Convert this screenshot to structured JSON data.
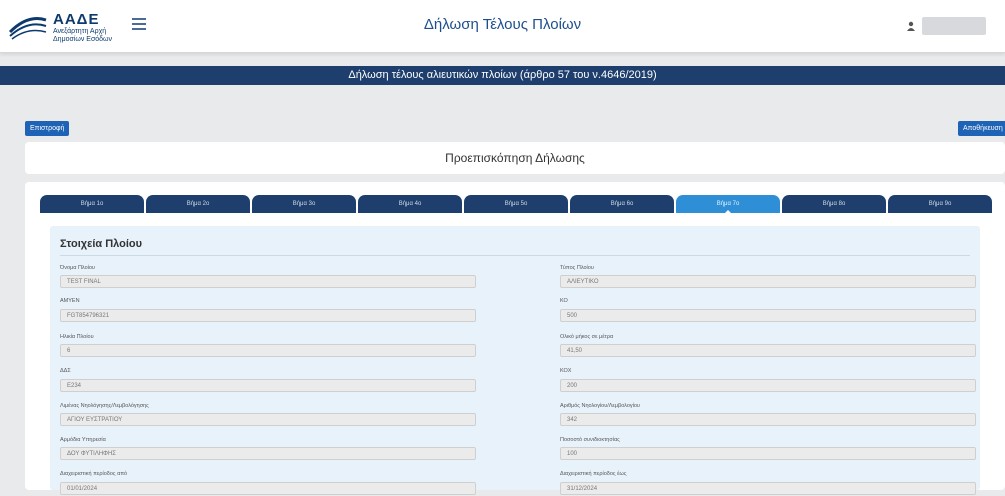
{
  "header": {
    "logo_title": "ΑΑΔΕ",
    "logo_subtitle": "Ανεξάρτητη Αρχή Δημοσίων Εσόδων",
    "app_title": "Δήλωση Τέλους Πλοίων"
  },
  "banner": {
    "text": "Δήλωση τέλους αλιευτικών πλοίων (άρθρο 57 του ν.4646/2019)"
  },
  "actions": {
    "back_label": "Επιστροφή",
    "save_label": "Αποθήκευση"
  },
  "preview": {
    "title": "Προεπισκόπηση Δήλωσης"
  },
  "tabs": [
    {
      "label": "Βήμα 1ο"
    },
    {
      "label": "Βήμα 2ο"
    },
    {
      "label": "Βήμα 3ο"
    },
    {
      "label": "Βήμα 4ο"
    },
    {
      "label": "Βήμα 5ο"
    },
    {
      "label": "Βήμα 6ο"
    },
    {
      "label": "Βήμα 7ο"
    },
    {
      "label": "Βήμα 8ο"
    },
    {
      "label": "Βήμα 9ο"
    }
  ],
  "active_tab": 6,
  "section": {
    "title": "Στοιχεία Πλοίου",
    "left": [
      {
        "label": "Όνομα Πλοίου",
        "value": "TEST FINAL"
      },
      {
        "label": "ΑΜΥΕΝ",
        "value": "FGT854796321"
      },
      {
        "label": "Ηλικία Πλοίου",
        "value": "6"
      },
      {
        "label": "ΔΔΣ",
        "value": "E234"
      },
      {
        "label": "Λιμένας Νηολόγησης/Λεμβολόγησης",
        "value": "ΑΓΙΟΥ ΕΥΣΤΡΑΤΙΟΥ"
      },
      {
        "label": "Αρμόδια Υπηρεσία",
        "value": "ΔΟΥ ΦΥΤΙΛΗΦΗΣ"
      },
      {
        "label": "Διαχειριστική περίοδος από",
        "value": "01/01/2024"
      }
    ],
    "right": [
      {
        "label": "Τύπος Πλοίου",
        "value": "ΑΛΙΕΥΤΙΚΟ"
      },
      {
        "label": "ΚΟ",
        "value": "500"
      },
      {
        "label": "Ολικό μήκος σε μέτρα",
        "value": "41,50"
      },
      {
        "label": "ΚΟΧ",
        "value": "200"
      },
      {
        "label": "Αριθμός Νηολογίου/Λεμβολογίου",
        "value": "342"
      },
      {
        "label": "Ποσοστό συνιδιοκτησίας",
        "value": "100"
      },
      {
        "label": "Διαχειριστική περίοδος έως",
        "value": "31/12/2024"
      }
    ]
  },
  "colors": {
    "primary_dark": "#1e3f6d",
    "primary": "#1e63b5",
    "tab_active": "#2e8fd6",
    "panel_bg": "#e8f2fb"
  }
}
